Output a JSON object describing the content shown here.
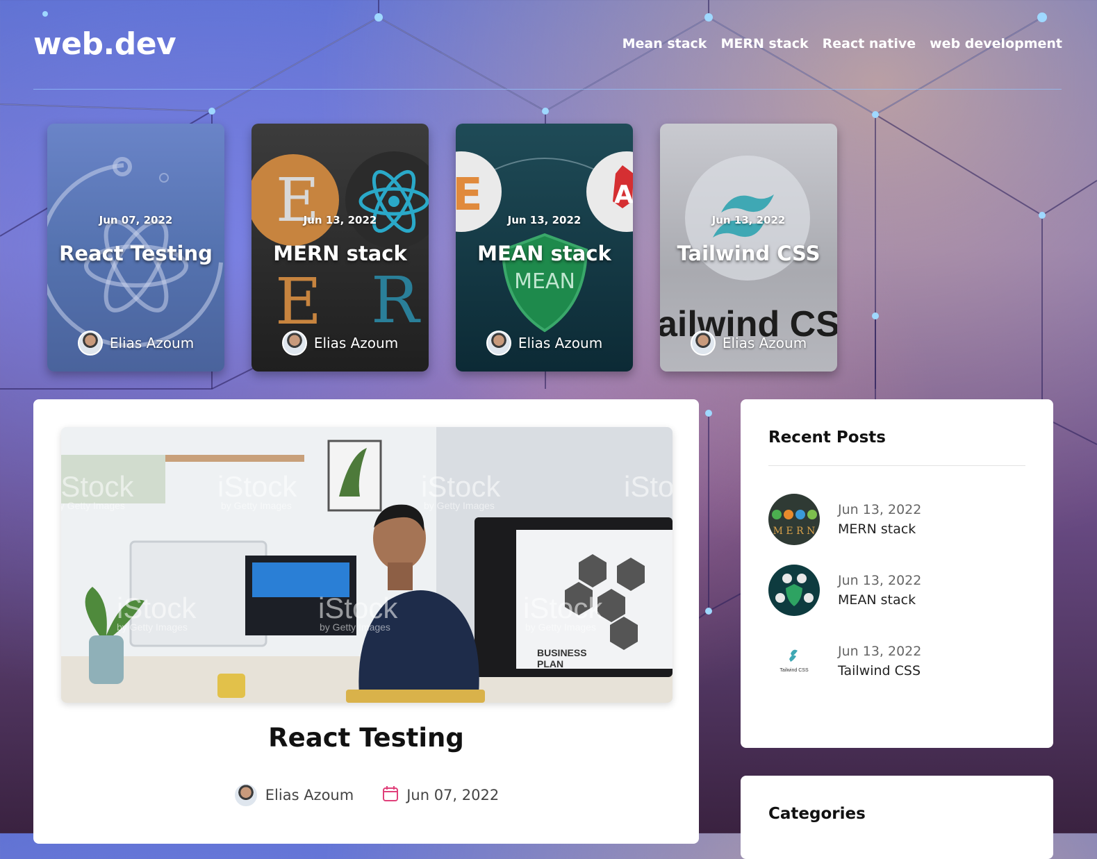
{
  "header": {
    "logo": "web.dev",
    "nav": [
      "Mean stack",
      "MERN stack",
      "React native",
      "web development"
    ]
  },
  "featured": [
    {
      "date": "Jun 07, 2022",
      "title": "React Testing",
      "author": "Elias Azoum"
    },
    {
      "date": "Jun 13, 2022",
      "title": "MERN stack",
      "author": "Elias Azoum"
    },
    {
      "date": "Jun 13, 2022",
      "title": "MEAN stack",
      "author": "Elias Azoum"
    },
    {
      "date": "Jun 13, 2022",
      "title": "Tailwind CSS",
      "author": "Elias Azoum"
    }
  ],
  "card_art": {
    "mern_letters": [
      "E",
      "E",
      "R"
    ],
    "mean_letters": [
      "E",
      "A",
      "MEAN"
    ],
    "tailwind_text": "ailwind CSS"
  },
  "article": {
    "title": "React Testing",
    "author": "Elias Azoum",
    "date": "Jun 07, 2022",
    "image_texts": {
      "watermark": "iStock",
      "watermark_sub": "by Getty Images",
      "poster_line1": "BUSINESS",
      "poster_line2": "PLAN"
    }
  },
  "sidebar": {
    "recent_title": "Recent Posts",
    "recent_posts": [
      {
        "date": "Jun 13, 2022",
        "title": "MERN stack"
      },
      {
        "date": "Jun 13, 2022",
        "title": "MEAN stack"
      },
      {
        "date": "Jun 13, 2022",
        "title": "Tailwind CSS"
      }
    ],
    "thumb_texts": {
      "mern": "M E R N",
      "tailwind": "Tailwind CSS"
    },
    "categories_title": "Categories"
  },
  "colors": {
    "accent_calendar": "#e0407a",
    "react_blue": "#61dafb",
    "mean_green": "#1f7a4a"
  }
}
